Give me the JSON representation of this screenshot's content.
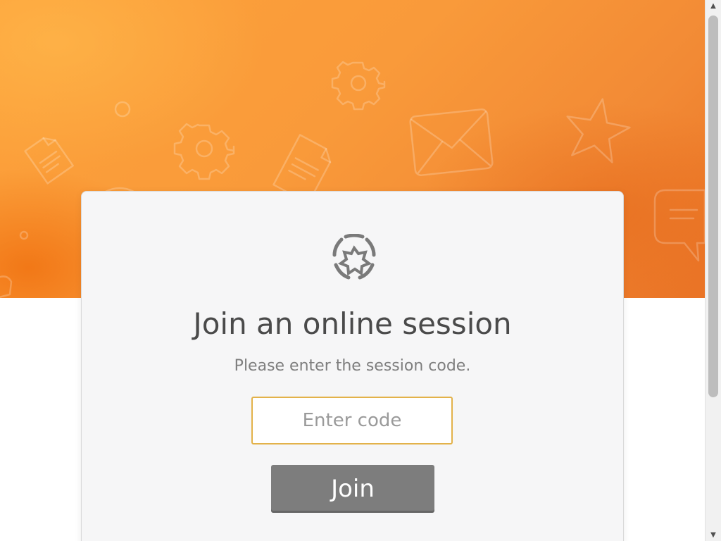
{
  "hero": {
    "decorations": [
      "document-icon",
      "gear-icon",
      "envelope-icon",
      "star-icon",
      "speech-bubble-icon",
      "circle-icon"
    ]
  },
  "card": {
    "logo_icon": "spark-burst-logo-icon",
    "title": "Join an online session",
    "subtitle": "Please enter the session code.",
    "code_input": {
      "value": "",
      "placeholder": "Enter code"
    },
    "join_label": "Join"
  },
  "colors": {
    "hero_orange": "#f99a3a",
    "card_background": "#f6f6f7",
    "input_border": "#e3b24a",
    "button_background": "#7d7d7d",
    "title_text": "#4a4a4a",
    "subtitle_text": "#7e7e7e"
  },
  "scrollbar": {
    "up_arrow": "▲",
    "down_arrow": "▼"
  }
}
